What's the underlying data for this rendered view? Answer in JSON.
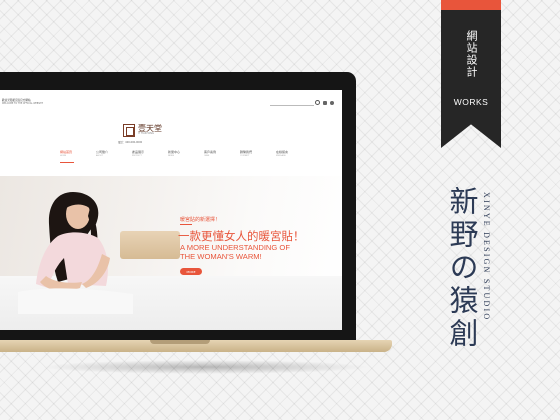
{
  "badge": {
    "title": "網站設計",
    "subtitle": "WORKS",
    "accent_color": "#e8553b",
    "background_color": "#262626"
  },
  "brand": {
    "name_cn": "新野の猿創",
    "name_en": "XINYE DESIGN STUDIO",
    "color": "#2c3a55"
  },
  "website": {
    "topbar_line1": "歡迎光臨暖宮貼官方網站",
    "topbar_line2": "WELCOME TO THE OFFICIAL WEBSITE",
    "logo_name": "壹天堂",
    "logo_sub": "YI TIAN TANG",
    "contact": "電話：400-000-0000",
    "nav": [
      {
        "label": "網站首頁",
        "sub": "HOME",
        "active": true
      },
      {
        "label": "公司簡介",
        "sub": "ABOUT",
        "active": false
      },
      {
        "label": "產品展示",
        "sub": "PRODUCT",
        "active": false
      },
      {
        "label": "新聞中心",
        "sub": "NEWS",
        "active": false
      },
      {
        "label": "客戶案例",
        "sub": "CASE",
        "active": false
      },
      {
        "label": "聯繫我們",
        "sub": "CONTACT",
        "active": false
      },
      {
        "label": "在線留言",
        "sub": "MESSAGE",
        "active": false
      }
    ],
    "hero": {
      "kicker": "暖宮貼的新選擇！",
      "title": "一款更懂女人的暖宮貼！",
      "title_en_line1": "A MORE UNDERSTANDING OF",
      "title_en_line2": "THE WOMAN'S WARM!",
      "button": "MORE"
    }
  },
  "icons": [
    "search-icon",
    "menu-icon",
    "user-icon"
  ]
}
